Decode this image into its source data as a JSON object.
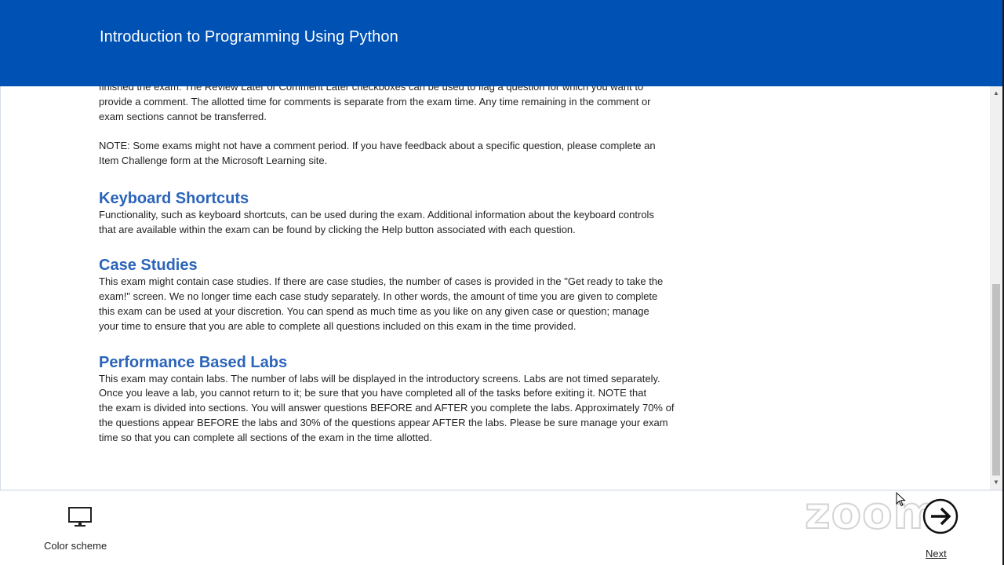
{
  "header": {
    "title": "Introduction to Programming Using Python"
  },
  "content": {
    "intro_lines": [
      "finished the exam. The Review Later or Comment Later checkboxes can be used to flag a question for which you want to",
      "provide a comment. The allotted time for comments is separate from the exam time. Any time remaining in the comment or",
      "exam sections cannot be transferred."
    ],
    "note_lines": [
      "NOTE: Some exams might not have a comment period. If you have feedback about a specific question, please complete an",
      "Item Challenge form at the Microsoft Learning site."
    ],
    "sections": [
      {
        "heading": "Keyboard Shortcuts",
        "lines": [
          "Functionality, such as keyboard shortcuts, can be used during the exam. Additional information about the keyboard controls",
          "that are available within the exam can be found by clicking the Help button associated with each question."
        ]
      },
      {
        "heading": "Case Studies",
        "lines": [
          "This exam might contain case studies. If there are case studies, the number of cases is provided in the \"Get ready to take the",
          "exam!\" screen. We no longer time each case study separately. In other words, the amount of time you are given to complete",
          "this exam can be used at your discretion. You can spend as much time as you like on any given case or question; manage",
          "your time to ensure that you are able to complete all questions included on this exam in the time provided."
        ]
      },
      {
        "heading": "Performance Based Labs",
        "lines": [
          "This exam may contain labs. The number of labs will be displayed in the introductory screens. Labs are not timed separately.",
          "Once you leave a lab, you cannot return to it; be sure that you have completed all of the tasks before exiting it. NOTE that",
          "the exam is divided into sections. You will answer questions BEFORE and AFTER you complete the labs. Approximately 70% of",
          "the questions appear BEFORE the labs and 30% of the questions appear AFTER the labs. Please be sure manage your exam",
          "time so that you can complete all sections of the exam in the time allotted."
        ]
      }
    ]
  },
  "footer": {
    "color_scheme_label": "Color scheme",
    "next_label": "Next",
    "watermark": "zoom"
  },
  "colors": {
    "header_bg": "#0051b4",
    "heading_blue": "#2b64b9"
  },
  "icons": {
    "color_scheme": "monitor-icon",
    "next": "arrow-right-circle-icon"
  }
}
